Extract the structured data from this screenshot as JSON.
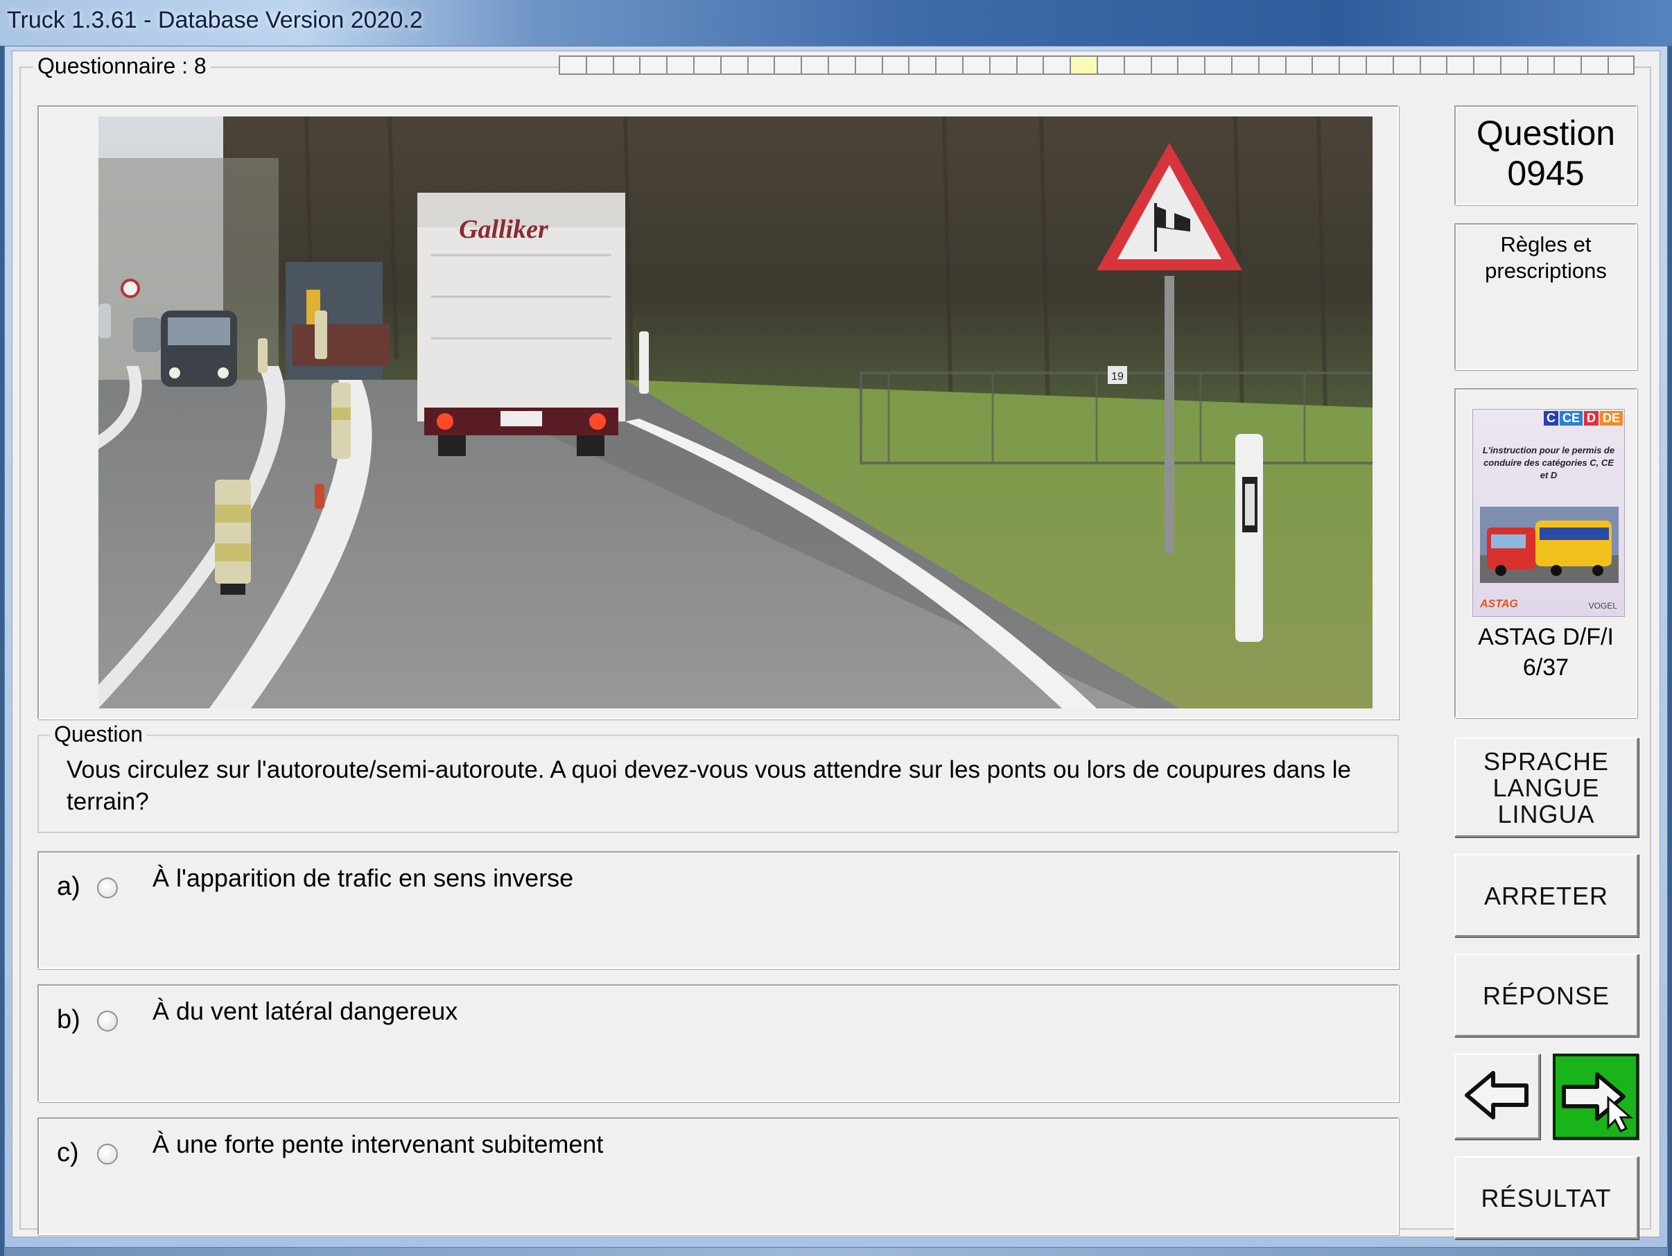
{
  "window": {
    "title": "Truck 1.3.61 - Database Version 2020.2"
  },
  "questionnaire": {
    "label": "Questionnaire : 8",
    "total_cells": 40,
    "current_cell": 20
  },
  "question_box": {
    "label": "Question",
    "text": "Vous circulez sur l'autoroute/semi-autoroute. A quoi devez-vous vous attendre sur les ponts ou lors de coupures dans le terrain?"
  },
  "answers": [
    {
      "letter": "a)",
      "text": "À l'apparition de trafic en sens inverse"
    },
    {
      "letter": "b)",
      "text": "À du vent latéral dangereux"
    },
    {
      "letter": "c)",
      "text": "À une forte pente intervenant subitement"
    }
  ],
  "sidebar": {
    "question_title": "Question",
    "question_number": "0945",
    "category": "Règles et prescriptions",
    "book": {
      "badge_c": "C",
      "badge_ce": "CE",
      "badge_d": "D",
      "badge_de": "DE",
      "cover_text": "L'instruction pour le permis de conduire des catégories C, CE et D",
      "logo_left": "ASTAG",
      "logo_right": "VOGEL",
      "name": "ASTAG D/F/I",
      "page": "6/37"
    },
    "language_button": "SPRACHE\nLANGUE\nLINGUA",
    "stop_button": "ARRETER",
    "answer_button": "RÉPONSE",
    "result_button": "RÉSULTAT"
  },
  "photo": {
    "truck_text": "Galliker",
    "sign_icon": "crosswind-warning-sign",
    "marker_number": "19"
  },
  "colors": {
    "next_button": "#19b419",
    "title_bar": "#3d6aa8"
  }
}
